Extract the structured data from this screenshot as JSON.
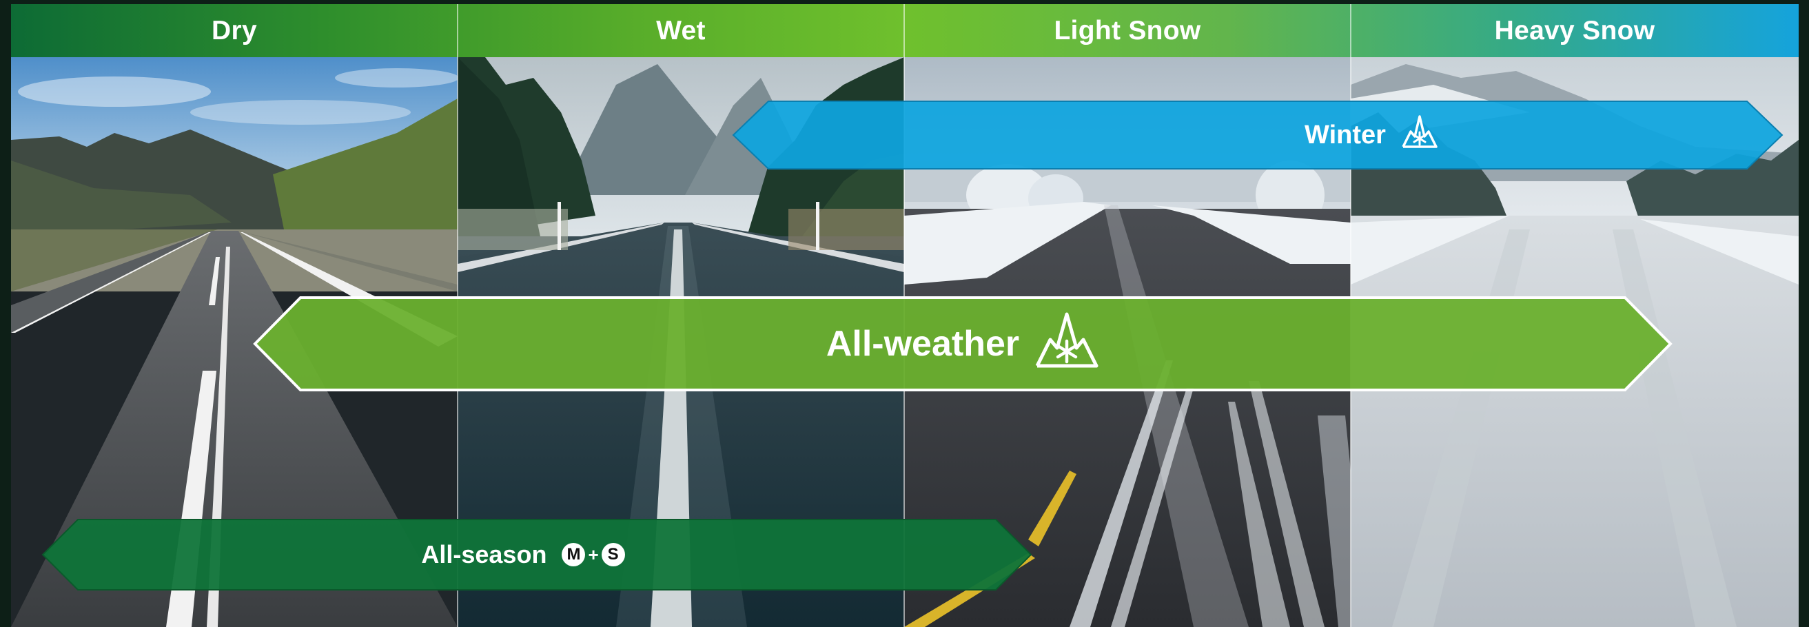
{
  "conditions": {
    "dry": "Dry",
    "wet": "Wet",
    "light_snow": "Light Snow",
    "heavy_snow": "Heavy Snow"
  },
  "bands": {
    "winter": {
      "label": "Winter",
      "icon": "three-peak-mountain-snowflake-icon",
      "color": "#0ea5df"
    },
    "all_weather": {
      "label": "All-weather",
      "icon": "three-peak-mountain-snowflake-icon",
      "color": "#6ab02e"
    },
    "all_season": {
      "label": "All-season",
      "icon": "m-plus-s-badge-icon",
      "badge_m": "M",
      "badge_plus": "+",
      "badge_s": "S",
      "color": "#0f7439"
    }
  },
  "colors": {
    "header_start": "#0d6b35",
    "header_mid": "#6fc02d",
    "header_end": "#15a3dc"
  }
}
